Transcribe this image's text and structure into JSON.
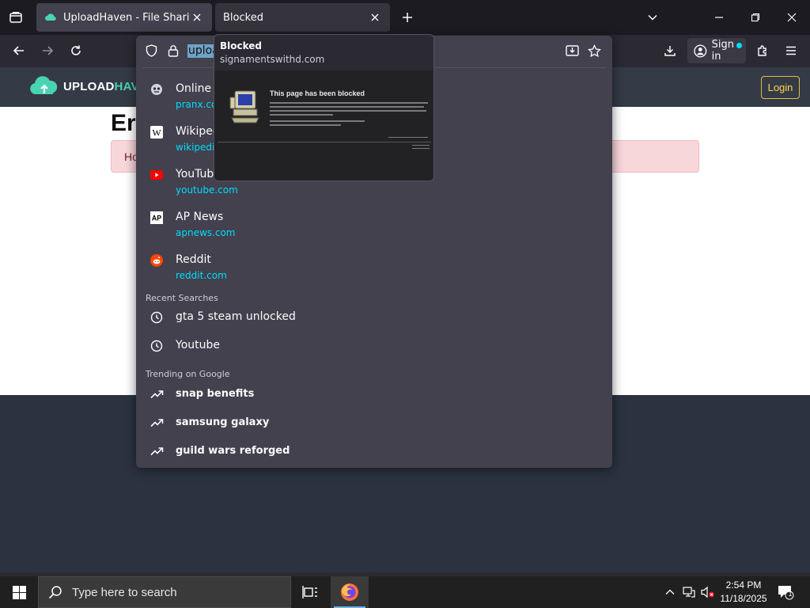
{
  "tabs": [
    {
      "title": "UploadHaven - File Sharing Made Simple",
      "active": true
    },
    {
      "title": "Blocked",
      "active": false
    }
  ],
  "tab_preview": {
    "title": "Blocked",
    "host": "signamentswithd.com",
    "thumb_heading": "This page has been blocked"
  },
  "urlbar": {
    "typed_text": "uploa"
  },
  "suggestions": [
    {
      "title": "Online V",
      "url": "pranx.com",
      "icon": "pranx-favicon"
    },
    {
      "title": "Wikipedia",
      "url": "wikipedia",
      "icon": "wikipedia-favicon"
    },
    {
      "title": "YouTube",
      "url": "youtube.com",
      "icon": "youtube-favicon"
    },
    {
      "title": "AP News",
      "url": "apnews.com",
      "icon": "apnews-favicon"
    },
    {
      "title": "Reddit",
      "url": "reddit.com",
      "icon": "reddit-favicon"
    }
  ],
  "recent_searches": {
    "label": "Recent Searches",
    "items": [
      "gta 5 steam unlocked",
      "Youtube"
    ]
  },
  "trending": {
    "label": "Trending on Google",
    "items": [
      "snap benefits",
      "samsung galaxy",
      "guild wars reforged"
    ]
  },
  "nav": {
    "signin_label": "Sign in"
  },
  "site": {
    "logo_upload": "UPLOAD",
    "logo_haven": "HAVEN",
    "login_label": "Login",
    "error_title": "Er",
    "alert_text": "Ho"
  },
  "taskbar": {
    "search_placeholder": "Type here to search",
    "time": "2:54 PM",
    "date": "11/18/2025",
    "notification_count": "1"
  },
  "colors": {
    "accent_cyan": "#00ddff",
    "site_teal": "#49d3b1",
    "login_gold": "#ffd54d"
  }
}
